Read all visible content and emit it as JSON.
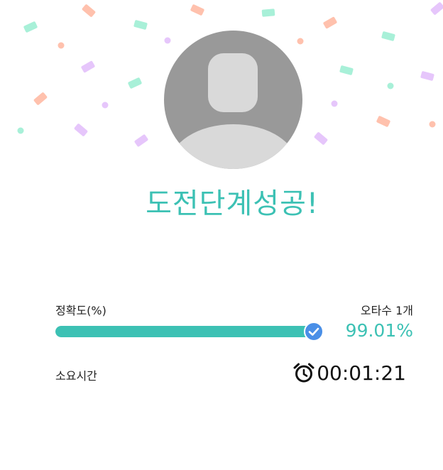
{
  "title": "도전단계성공!",
  "accuracy": {
    "label": "정확도(%)",
    "value_text": "99.01%",
    "fraction": 0.9901,
    "typos_text": "오타수 1개",
    "status_icon": "check-circle-icon"
  },
  "duration": {
    "label": "소요시간",
    "value": "00:01:21",
    "icon": "alarm-clock-icon"
  },
  "avatar": {
    "icon": "user-silhouette-icon"
  },
  "colors": {
    "accent": "#3cc1b4",
    "track": "#e6e6e6",
    "check": "#4a8fe7",
    "avatar_bg": "#999999",
    "avatar_fg": "#d9d9d9"
  }
}
